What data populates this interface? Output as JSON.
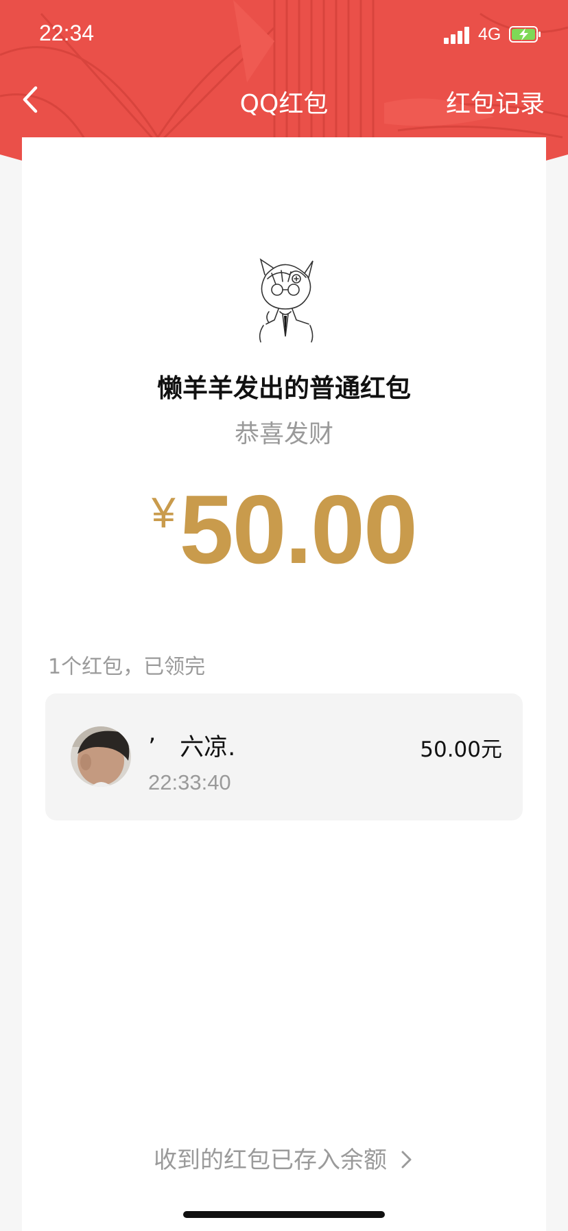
{
  "status_bar": {
    "time": "22:34",
    "network": "4G",
    "battery_icon": "battery-charging-icon",
    "signal_icon": "cellular-signal-icon"
  },
  "nav": {
    "back_icon": "chevron-left-icon",
    "title": "QQ红包",
    "right_label": "红包记录"
  },
  "packet": {
    "title": "懒羊羊发出的普通红包",
    "greeting": "恭喜发财",
    "currency": "¥",
    "amount": "50.00"
  },
  "receive_summary": "1个红包，已领完",
  "records": [
    {
      "name": "’　六凉.",
      "time": "22:33:40",
      "amount": "50.00元"
    }
  ],
  "footer": {
    "link_label": "收到的红包已存入余额",
    "chevron_icon": "chevron-right-icon"
  },
  "colors": {
    "header_red": "#ea5049",
    "amount_gold": "#c99b4c",
    "muted_gray": "#9a9a9a"
  }
}
